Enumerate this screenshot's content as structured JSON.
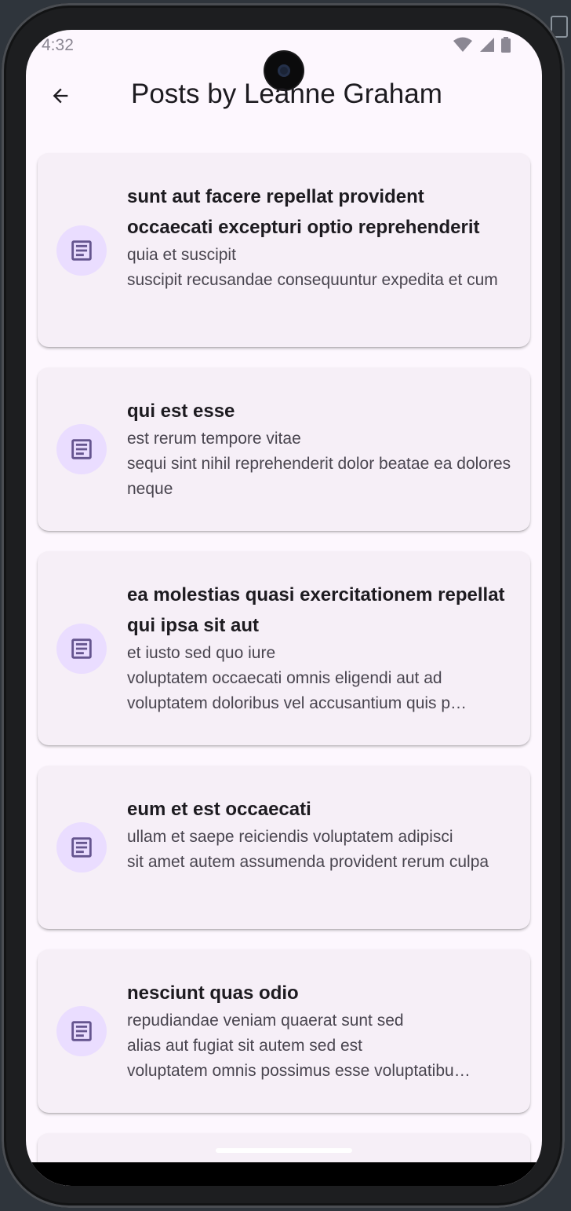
{
  "status_bar": {
    "time": "4:32"
  },
  "app_bar": {
    "title": "Posts by Leanne Graham",
    "back_icon": "arrow-left-icon"
  },
  "colors": {
    "screen_bg": "#fdf7fe",
    "card_bg": "#f6eff7",
    "icon_circle": "#eaddff",
    "icon_color": "#65558f",
    "title_text": "#1d1b20",
    "body_text": "#49454f"
  },
  "posts": [
    {
      "icon": "article-icon",
      "title": "sunt aut facere repellat provident occaecati excepturi optio reprehenderit",
      "body": "quia et suscipit\nsuscipit recusandae consequuntur expedita et cum"
    },
    {
      "icon": "article-icon",
      "title": "qui est esse",
      "body": "est rerum tempore vitae\nsequi sint nihil reprehenderit dolor beatae ea dolores neque"
    },
    {
      "icon": "article-icon",
      "title": "ea molestias quasi exercitationem repellat qui ipsa sit aut",
      "body": "et iusto sed quo iure\nvoluptatem occaecati omnis eligendi aut ad\nvoluptatem doloribus vel accusantium quis p…"
    },
    {
      "icon": "article-icon",
      "title": "eum et est occaecati",
      "body": "ullam et saepe reiciendis voluptatem adipisci\nsit amet autem assumenda provident rerum culpa"
    },
    {
      "icon": "article-icon",
      "title": "nesciunt quas odio",
      "body": "repudiandae veniam quaerat sunt sed\nalias aut fugiat sit autem sed est\nvoluptatem omnis possimus esse voluptatibu…"
    }
  ]
}
